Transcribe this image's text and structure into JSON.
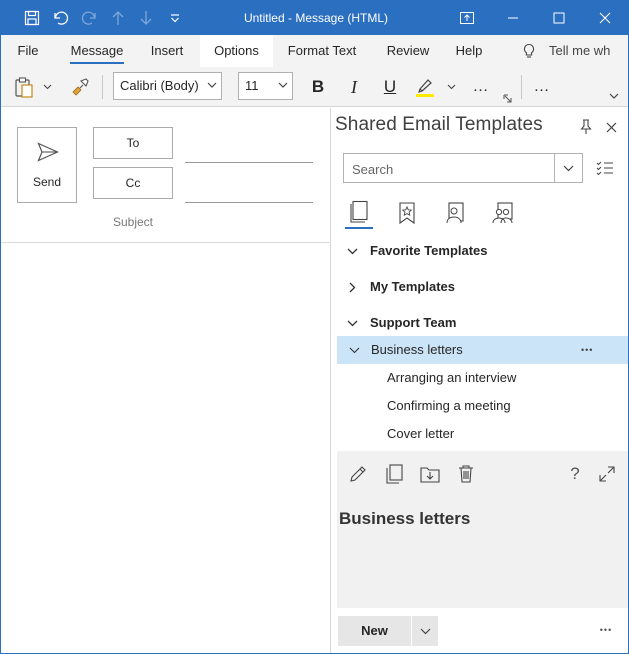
{
  "window": {
    "title": "Untitled  -  Message (HTML)",
    "accent": "#2b6fc0"
  },
  "quick_access": [
    "save-icon",
    "undo-icon",
    "redo-icon",
    "up-arrow-icon",
    "down-arrow-icon",
    "customize-icon"
  ],
  "menu": {
    "tabs": [
      "File",
      "Message",
      "Insert",
      "Options",
      "Format Text",
      "Review",
      "Help"
    ],
    "active_tab": "Message",
    "tell_me": "Tell me wh"
  },
  "ribbon": {
    "font_name": "Calibri (Body)",
    "font_size": "11",
    "bold": "B",
    "italic": "I",
    "underline": "U",
    "more": "…",
    "highlight_color": "#ffeb00"
  },
  "compose": {
    "send_label": "Send",
    "to_label": "To",
    "cc_label": "Cc",
    "subject_label": "Subject"
  },
  "pane": {
    "title": "Shared Email Templates",
    "search_placeholder": "Search",
    "tree": [
      {
        "label": "Favorite Templates",
        "state": "expanded"
      },
      {
        "label": "My Templates",
        "state": "collapsed"
      },
      {
        "label": "Support Team",
        "state": "expanded"
      },
      {
        "label": "Business letters",
        "state": "expanded",
        "selected": true,
        "more": "•••"
      },
      {
        "label": "Arranging an interview"
      },
      {
        "label": "Confirming a meeting"
      },
      {
        "label": "Cover letter"
      }
    ],
    "help": "?",
    "detail_title": "Business letters",
    "new_label": "New",
    "more": "•••",
    "selected_color": "#cce4f7"
  }
}
